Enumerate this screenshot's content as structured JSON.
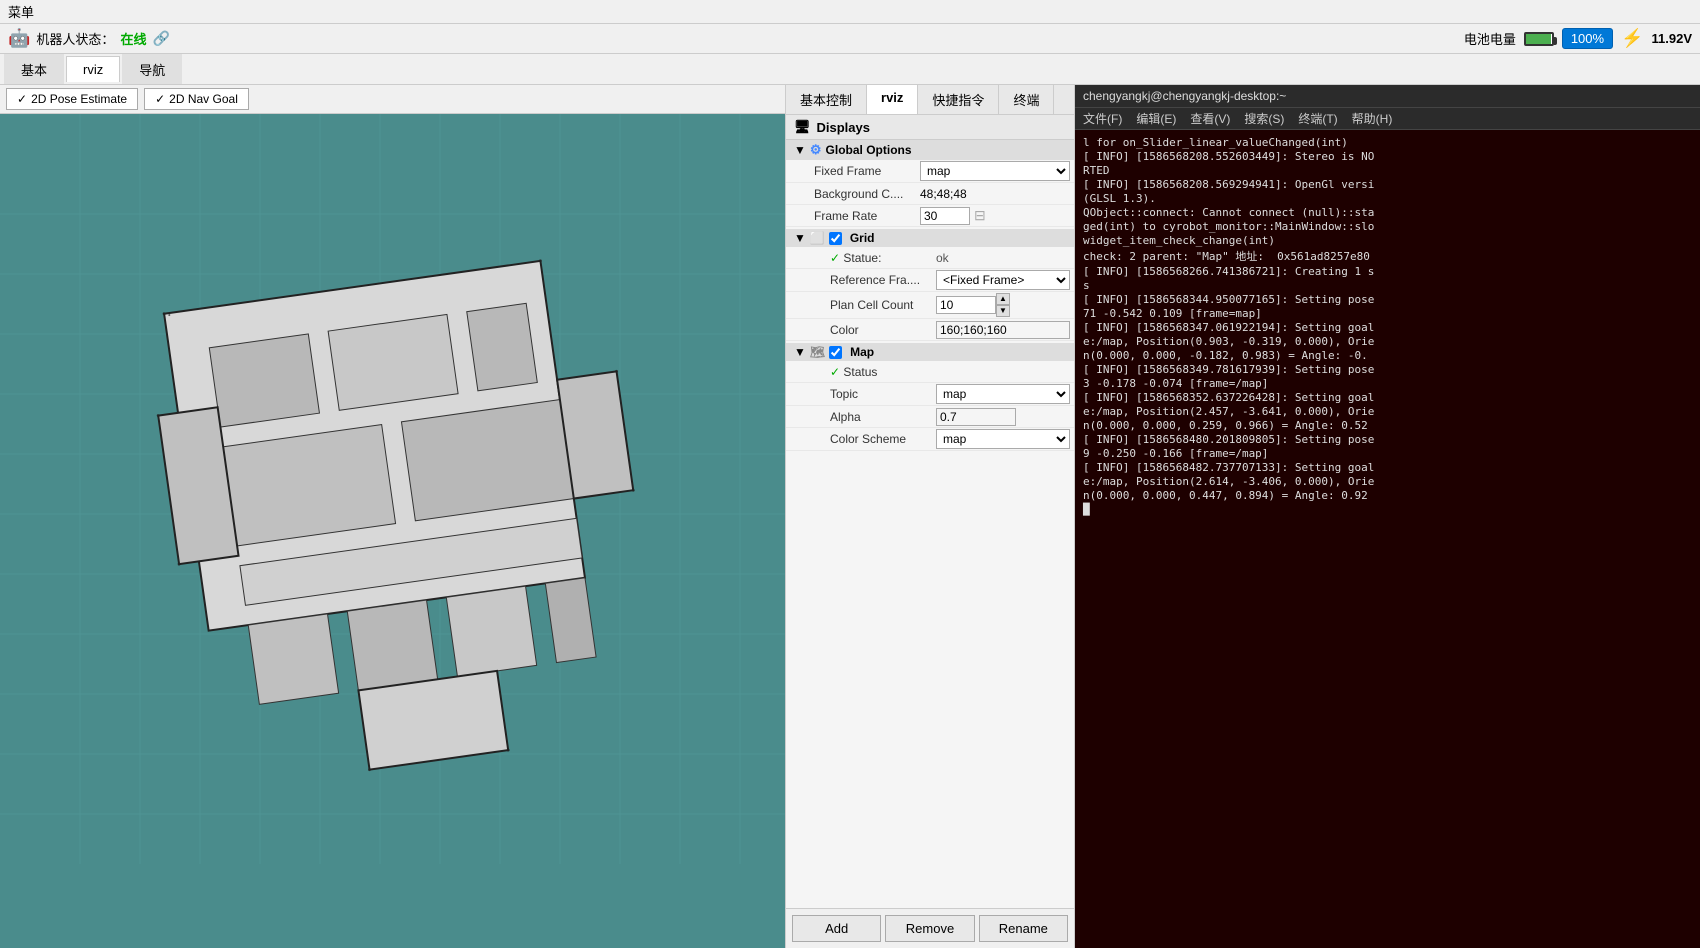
{
  "menubar": {
    "label": "菜单"
  },
  "topbar": {
    "robot_label": "机器人状态：",
    "status": "在线",
    "battery_label": "电池电量",
    "battery_percent": "100%",
    "voltage": "11.92V"
  },
  "main_tabs": [
    {
      "id": "jiben",
      "label": "基本"
    },
    {
      "id": "rviz",
      "label": "rviz",
      "active": true
    },
    {
      "id": "daohang",
      "label": "导航"
    }
  ],
  "rviz_toolbar": {
    "pose_btn": "2D Pose Estimate",
    "nav_btn": "2D Nav Goal"
  },
  "panel_tabs": [
    {
      "id": "jibenkongzhi",
      "label": "基本控制"
    },
    {
      "id": "rviz",
      "label": "rviz",
      "active": true
    },
    {
      "id": "kuaijiezhiling",
      "label": "快捷指令"
    },
    {
      "id": "zhongduan",
      "label": "终端"
    }
  ],
  "displays": {
    "header": "Displays",
    "global_options": {
      "label": "Global Options",
      "fixed_frame_label": "Fixed Frame",
      "fixed_frame_value": "map",
      "bg_color_label": "Background C....",
      "bg_color_value": "48;48;48",
      "frame_rate_label": "Frame Rate",
      "frame_rate_value": "30",
      "grid_label": "Grid",
      "grid_checked": true,
      "grid_status_label": "Statue:",
      "grid_status_value": "ok",
      "reference_frame_label": "Reference Fra....",
      "reference_frame_value": "<Fixed Frame>",
      "plan_cell_count_label": "Plan Cell Count",
      "plan_cell_count_value": "10",
      "color_label": "Color",
      "color_value": "160;160;160",
      "map_label": "Map",
      "map_checked": true,
      "map_status_label": "Status",
      "map_status_value": "",
      "topic_label": "Topic",
      "topic_value": "map",
      "alpha_label": "Alpha",
      "alpha_value": "0.7",
      "color_scheme_label": "Color Scheme",
      "color_scheme_value": "map"
    }
  },
  "footer_buttons": {
    "add": "Add",
    "remove": "Remove",
    "rename": "Rename"
  },
  "terminal": {
    "title": "chengyangkj@chengyangkj-desktop:~",
    "menu_items": [
      "文件(F)",
      "编辑(E)",
      "查看(V)",
      "搜索(S)",
      "终端(T)",
      "帮助(H)"
    ],
    "lines": [
      "l for on_Slider_linear_valueChanged(int)",
      "[ INFO] [1586568208.552603449]: Stereo is NO",
      "RTED",
      "[ INFO] [1586568208.569294941]: OpenGl versi",
      "(GLSL 1.3).",
      "QObject::connect: Cannot connect (null)::sta",
      "ged(int) to cyrobot_monitor::MainWindow::slo",
      "widget_item_check_change(int)",
      "check: 2 parent: \"Map\" 地址:  0x561ad8257e80",
      "[ INFO] [1586568266.741386721]: Creating 1 s",
      "s",
      "[ INFO] [1586568344.950077165]: Setting pose",
      "71 -0.542 0.109 [frame=map]",
      "[ INFO] [1586568347.061922194]: Setting goal",
      "e:/map, Position(0.903, -0.319, 0.000), Orie",
      "n(0.000, 0.000, -0.182, 0.983) = Angle: -0.",
      "",
      "[ INFO] [1586568349.781617939]: Setting pose",
      "3 -0.178 -0.074 [frame=/map]",
      "[ INFO] [1586568352.637226428]: Setting goal",
      "e:/map, Position(2.457, -3.641, 0.000), Orie",
      "n(0.000, 0.000, 0.259, 0.966) = Angle: 0.52",
      "",
      "[ INFO] [1586568480.201809805]: Setting pose",
      "9 -0.250 -0.166 [frame=/map]",
      "[ INFO] [1586568482.737707133]: Setting goal",
      "e:/map, Position(2.614, -3.406, 0.000), Orie",
      "n(0.000, 0.000, 0.447, 0.894) = Angle: 0.92",
      "█"
    ]
  }
}
